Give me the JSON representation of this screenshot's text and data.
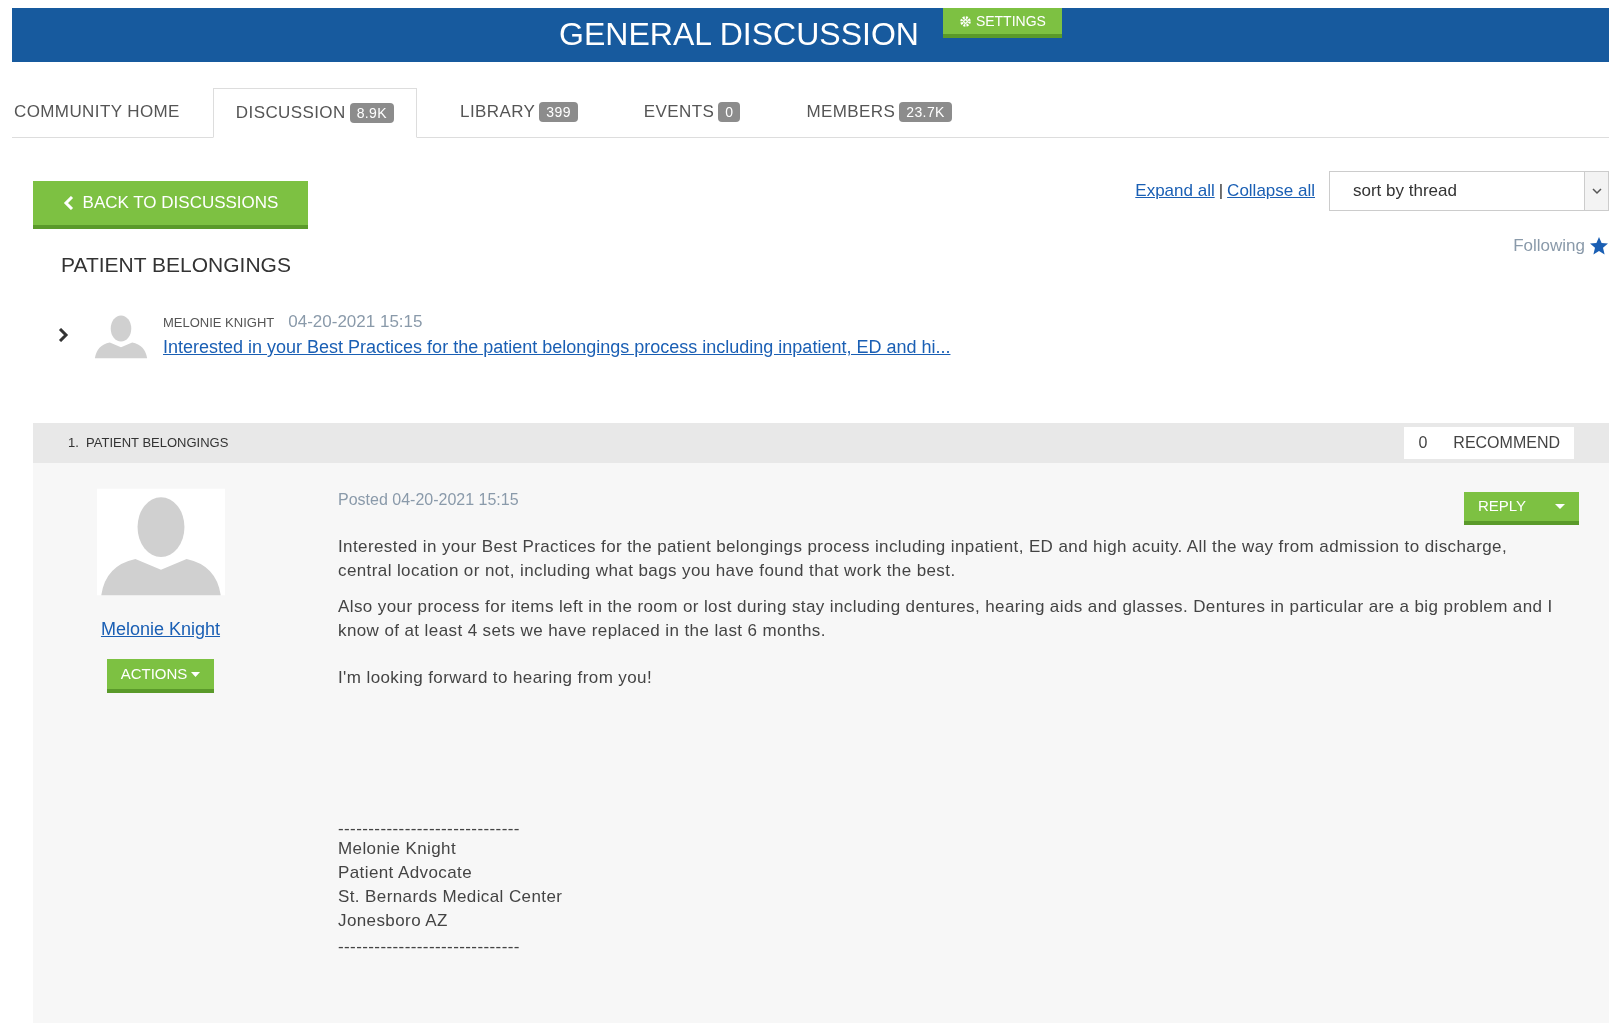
{
  "header": {
    "title": "GENERAL DISCUSSION",
    "settings_button": "SETTINGS"
  },
  "tabs": [
    {
      "label": "COMMUNITY HOME",
      "selected": false
    },
    {
      "label": "DISCUSSION",
      "count": "8.9K",
      "selected": true
    },
    {
      "label": "LIBRARY",
      "count": "399",
      "selected": false
    },
    {
      "label": "EVENTS",
      "count": "0",
      "selected": false
    },
    {
      "label": "MEMBERS",
      "count": "23.7K",
      "selected": false
    }
  ],
  "back_button": "BACK TO DISCUSSIONS",
  "expand_all": "Expand all",
  "separator": "|",
  "collapse_all": "Collapse all",
  "sort_select": {
    "value": "sort by thread"
  },
  "thread_title": "PATIENT BELONGINGS",
  "following": "Following",
  "thread_summary": {
    "author": "MELONIE KNIGHT",
    "date": "04-20-2021 15:15",
    "expanded": false,
    "link": "Interested in your Best Practices for the patient belongings process including inpatient, ED and hi..."
  },
  "post": {
    "heading": "1.  PATIENT BELONGINGS",
    "recommend_count": "0",
    "recommend_label": "RECOMMEND",
    "author": "Melonie Knight",
    "actions_button": "ACTIONS",
    "posted": "Posted 04-20-2021 15:15",
    "reply_button": "REPLY",
    "paragraphs": [
      "Interested in your Best Practices for the patient belongings process including inpatient, ED and high acuity.  All the way from admission to discharge, central location or not, including what bags you have found that work the best.",
      "Also your process for items left in the room or lost during stay including dentures, hearing aids and glasses.  Dentures in particular are a big problem and I know of at least 4 sets we have replaced in the last 6 months.",
      "I'm looking forward to hearing from you!"
    ],
    "signature": [
      "------------------------------",
      "Melonie Knight",
      "Patient Advocate",
      "St. Bernards Medical Center",
      "Jonesboro AZ",
      "------------------------------"
    ]
  }
}
